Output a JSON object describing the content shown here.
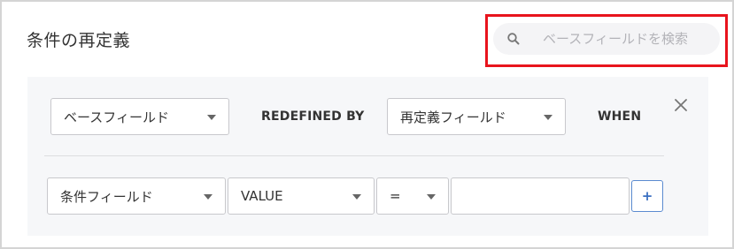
{
  "page": {
    "title": "条件の再定義"
  },
  "search": {
    "placeholder": "ベースフィールドを検索",
    "value": "",
    "highlight_color": "#e8141d"
  },
  "row1": {
    "base_field": {
      "selected": "ベースフィールド"
    },
    "redefined_by_label": "REDEFINED BY",
    "redefine_field": {
      "selected": "再定義フィールド"
    },
    "when_label": "WHEN",
    "close_icon": "close-icon"
  },
  "row2": {
    "condition_field": {
      "selected": "条件フィールド"
    },
    "value_type": {
      "selected": "VALUE"
    },
    "operator": {
      "selected": "="
    },
    "value_input": {
      "value": ""
    },
    "add_label": "+"
  },
  "colors": {
    "panel_bg": "#f6f7f9",
    "add_button": "#3a6fc1"
  }
}
